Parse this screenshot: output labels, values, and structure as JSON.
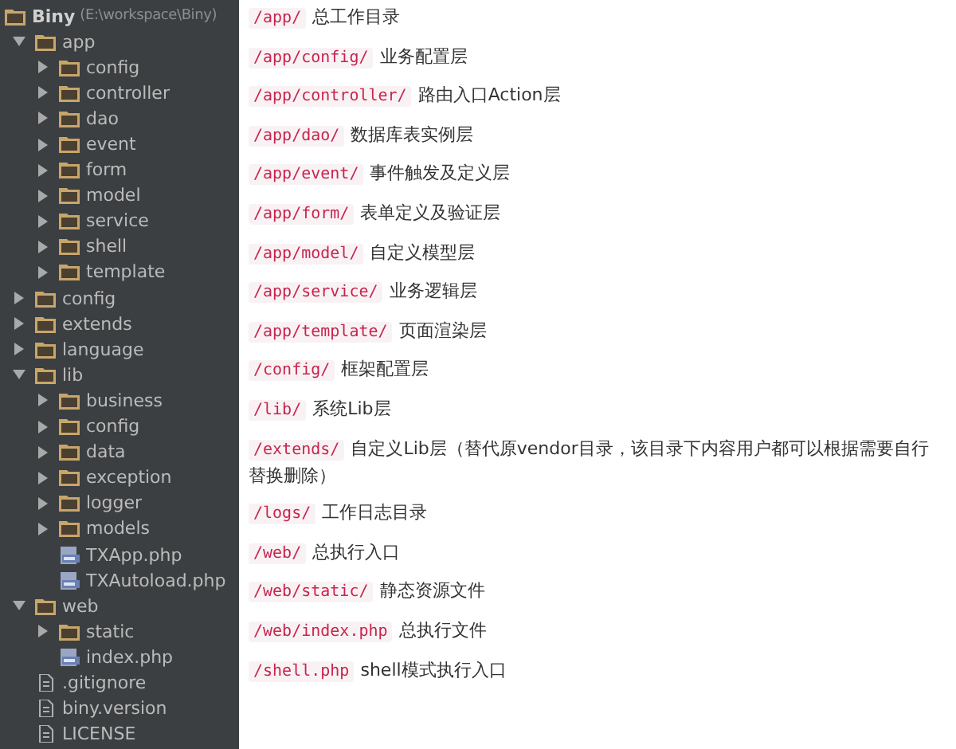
{
  "project": {
    "name": "Biny",
    "path": "(E:\\workspace\\Biny)",
    "children": [
      {
        "name": "app",
        "kind": "folder",
        "expanded": true,
        "children": [
          {
            "name": "config",
            "kind": "folder",
            "expanded": false
          },
          {
            "name": "controller",
            "kind": "folder",
            "expanded": false
          },
          {
            "name": "dao",
            "kind": "folder",
            "expanded": false
          },
          {
            "name": "event",
            "kind": "folder",
            "expanded": false
          },
          {
            "name": "form",
            "kind": "folder",
            "expanded": false
          },
          {
            "name": "model",
            "kind": "folder",
            "expanded": false
          },
          {
            "name": "service",
            "kind": "folder",
            "expanded": false
          },
          {
            "name": "shell",
            "kind": "folder",
            "expanded": false
          },
          {
            "name": "template",
            "kind": "folder",
            "expanded": false
          }
        ]
      },
      {
        "name": "config",
        "kind": "folder",
        "expanded": false
      },
      {
        "name": "extends",
        "kind": "folder",
        "expanded": false
      },
      {
        "name": "language",
        "kind": "folder",
        "expanded": false
      },
      {
        "name": "lib",
        "kind": "folder",
        "expanded": true,
        "children": [
          {
            "name": "business",
            "kind": "folder",
            "expanded": false
          },
          {
            "name": "config",
            "kind": "folder",
            "expanded": false
          },
          {
            "name": "data",
            "kind": "folder",
            "expanded": false
          },
          {
            "name": "exception",
            "kind": "folder",
            "expanded": false
          },
          {
            "name": "logger",
            "kind": "folder",
            "expanded": false
          },
          {
            "name": "models",
            "kind": "folder",
            "expanded": false
          },
          {
            "name": "TXApp.php",
            "kind": "php"
          },
          {
            "name": "TXAutoload.php",
            "kind": "php"
          }
        ]
      },
      {
        "name": "web",
        "kind": "folder",
        "expanded": true,
        "children": [
          {
            "name": "static",
            "kind": "folder",
            "expanded": false
          },
          {
            "name": "index.php",
            "kind": "php"
          }
        ]
      },
      {
        "name": ".gitignore",
        "kind": "file"
      },
      {
        "name": "biny.version",
        "kind": "file"
      },
      {
        "name": "LICENSE",
        "kind": "file"
      }
    ]
  },
  "entries": [
    {
      "path": "/app/",
      "text": "总工作目录"
    },
    {
      "path": "/app/config/",
      "text": "业务配置层"
    },
    {
      "path": "/app/controller/",
      "text": "路由入口Action层"
    },
    {
      "path": "/app/dao/",
      "text": "数据库表实例层"
    },
    {
      "path": "/app/event/",
      "text": "事件触发及定义层"
    },
    {
      "path": "/app/form/",
      "text": "表单定义及验证层"
    },
    {
      "path": "/app/model/",
      "text": "自定义模型层"
    },
    {
      "path": "/app/service/",
      "text": "业务逻辑层"
    },
    {
      "path": "/app/template/",
      "text": "页面渲染层"
    },
    {
      "path": "/config/",
      "text": "框架配置层"
    },
    {
      "path": "/lib/",
      "text": "系统Lib层"
    },
    {
      "path": "/extends/",
      "text": "自定义Lib层（替代原vendor目录，该目录下内容用户都可以根据需要自行替换删除）"
    },
    {
      "path": "/logs/",
      "text": "工作日志目录"
    },
    {
      "path": "/web/",
      "text": "总执行入口"
    },
    {
      "path": "/web/static/",
      "text": "静态资源文件"
    },
    {
      "path": "/web/index.php",
      "text": "总执行文件"
    },
    {
      "path": "/shell.php",
      "text": "shell模式执行入口"
    }
  ]
}
